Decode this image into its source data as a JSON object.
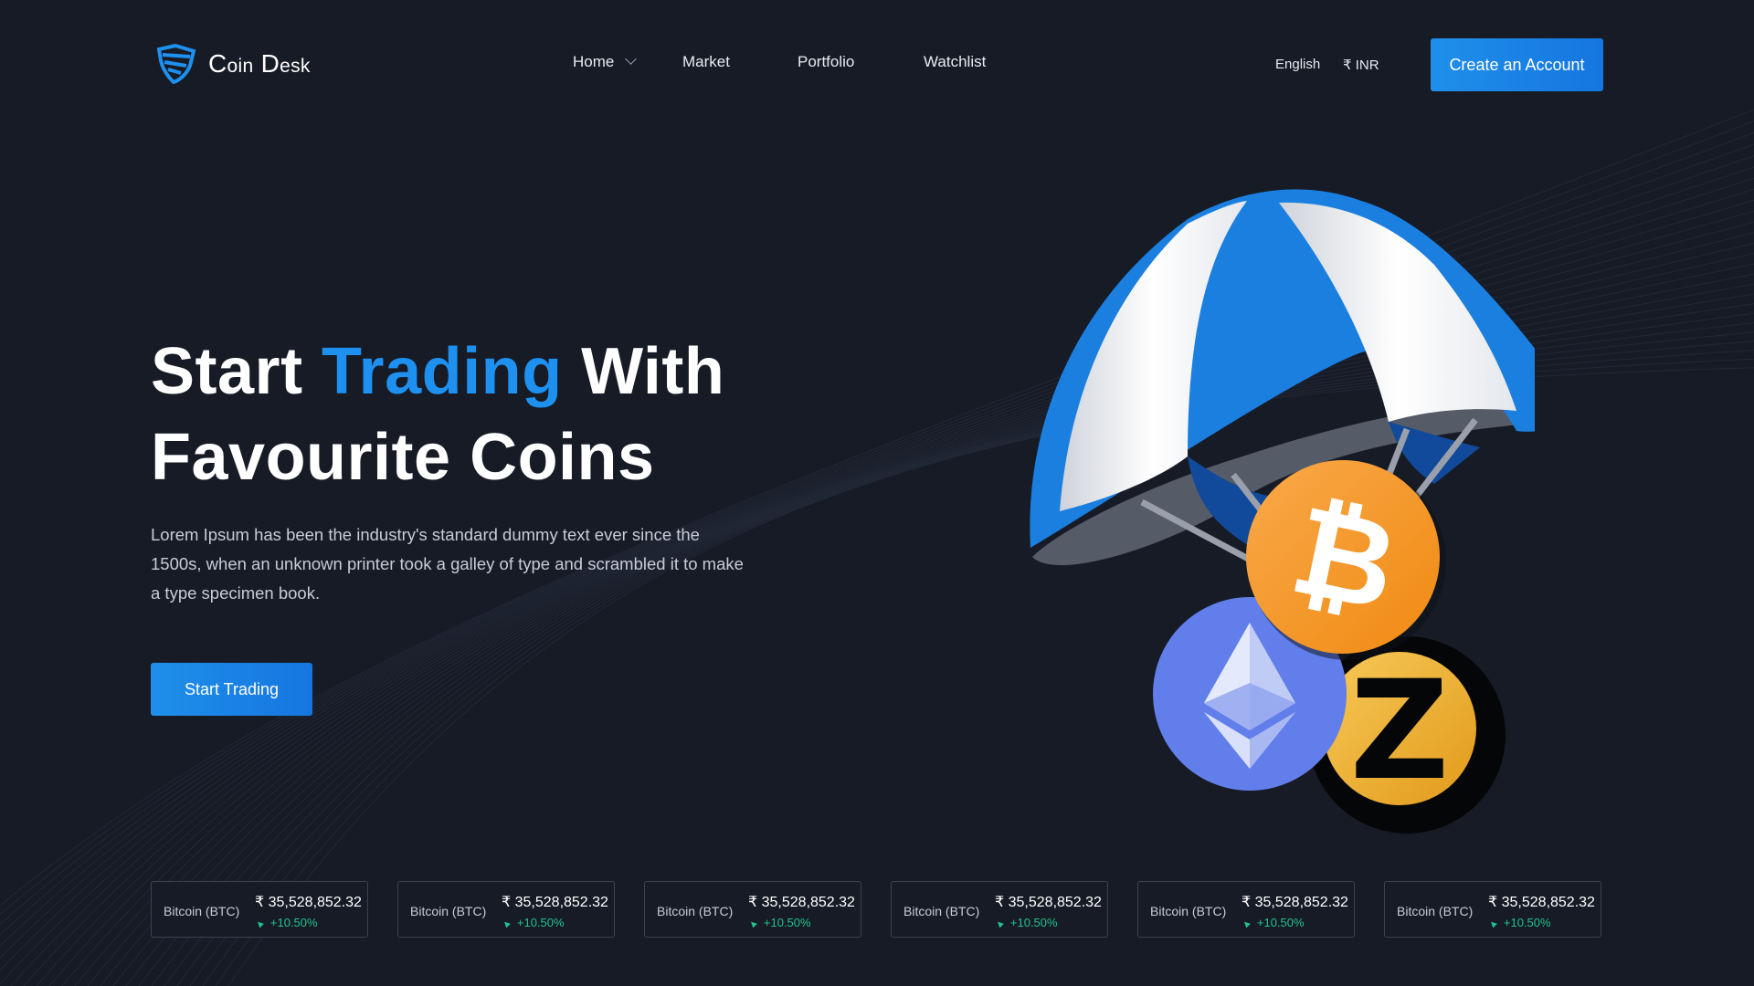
{
  "brand": {
    "name_part1_big": "C",
    "name_part1_small": "oin",
    "name_part2_big": "D",
    "name_part2_small": "esk",
    "logo_icon": "shield-icon",
    "accent_color": "#1e90f0"
  },
  "nav": {
    "items": [
      "Home",
      "Market",
      "Portfolio",
      "Watchlist"
    ],
    "home_dropdown_icon": "chevron-down-icon",
    "language": "English",
    "currency": "₹ INR",
    "cta_label": "Create an Account"
  },
  "hero": {
    "title_start": "Start ",
    "title_accent": "Trading",
    "title_mid": " With",
    "title_line2": "Favourite Coins",
    "description": "Lorem Ipsum has been the industry's standard dummy text ever since the 1500s, when an unknown printer took a galley of type and scrambled it to make a type specimen book.",
    "cta_label": "Start Trading"
  },
  "illustration": {
    "icons": [
      "parachute-icon",
      "bitcoin-icon",
      "ethereum-icon",
      "zcash-icon"
    ],
    "bitcoin_symbol": "₿",
    "zcash_symbol": "Z"
  },
  "tickers": [
    {
      "name": "Bitcoin (BTC)",
      "price": "₹ 35,528,852.32",
      "change": "+10.50%"
    },
    {
      "name": "Bitcoin (BTC)",
      "price": "₹ 35,528,852.32",
      "change": "+10.50%"
    },
    {
      "name": "Bitcoin (BTC)",
      "price": "₹ 35,528,852.32",
      "change": "+10.50%"
    },
    {
      "name": "Bitcoin (BTC)",
      "price": "₹ 35,528,852.32",
      "change": "+10.50%"
    },
    {
      "name": "Bitcoin (BTC)",
      "price": "₹ 35,528,852.32",
      "change": "+10.50%"
    },
    {
      "name": "Bitcoin (BTC)",
      "price": "₹ 35,528,852.32",
      "change": "+10.50%"
    }
  ],
  "ticker_up_icon": "arrow-up-right-icon",
  "colors": {
    "background": "#161b26",
    "primary_button": "#1a84e8",
    "positive": "#22c38a",
    "bitcoin": "#f5921f",
    "ethereum": "#627eea",
    "zcash": "#f4b728"
  }
}
